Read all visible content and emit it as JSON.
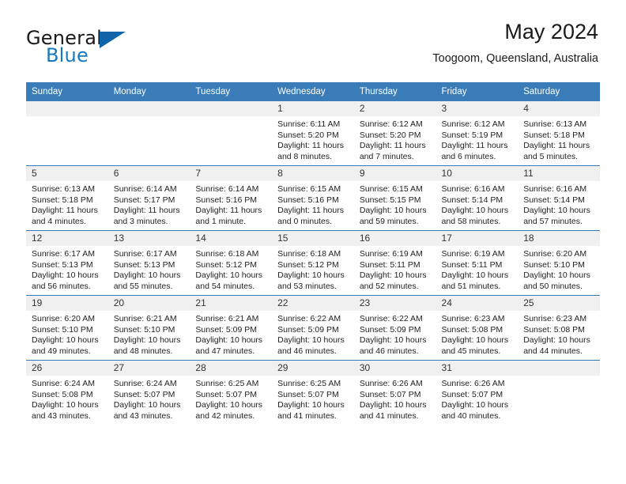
{
  "brand": {
    "name_top": "General",
    "name_bottom": "Blue",
    "accent_color": "#1879bf"
  },
  "header": {
    "title": "May 2024",
    "subtitle": "Toogoom, Queensland, Australia"
  },
  "calendar": {
    "header_bg": "#3a7cb8",
    "daynum_bg": "#f0f0f0",
    "weekday_headers": [
      "Sunday",
      "Monday",
      "Tuesday",
      "Wednesday",
      "Thursday",
      "Friday",
      "Saturday"
    ],
    "labels": {
      "sunrise": "Sunrise:",
      "sunset": "Sunset:",
      "daylight": "Daylight:"
    },
    "weeks": [
      [
        {
          "day": "",
          "empty": true
        },
        {
          "day": "",
          "empty": true
        },
        {
          "day": "",
          "empty": true
        },
        {
          "day": "1",
          "sunrise": "Sunrise: 6:11 AM",
          "sunset": "Sunset: 5:20 PM",
          "daylight_1": "Daylight: 11 hours",
          "daylight_2": "and 8 minutes."
        },
        {
          "day": "2",
          "sunrise": "Sunrise: 6:12 AM",
          "sunset": "Sunset: 5:20 PM",
          "daylight_1": "Daylight: 11 hours",
          "daylight_2": "and 7 minutes."
        },
        {
          "day": "3",
          "sunrise": "Sunrise: 6:12 AM",
          "sunset": "Sunset: 5:19 PM",
          "daylight_1": "Daylight: 11 hours",
          "daylight_2": "and 6 minutes."
        },
        {
          "day": "4",
          "sunrise": "Sunrise: 6:13 AM",
          "sunset": "Sunset: 5:18 PM",
          "daylight_1": "Daylight: 11 hours",
          "daylight_2": "and 5 minutes."
        }
      ],
      [
        {
          "day": "5",
          "sunrise": "Sunrise: 6:13 AM",
          "sunset": "Sunset: 5:18 PM",
          "daylight_1": "Daylight: 11 hours",
          "daylight_2": "and 4 minutes."
        },
        {
          "day": "6",
          "sunrise": "Sunrise: 6:14 AM",
          "sunset": "Sunset: 5:17 PM",
          "daylight_1": "Daylight: 11 hours",
          "daylight_2": "and 3 minutes."
        },
        {
          "day": "7",
          "sunrise": "Sunrise: 6:14 AM",
          "sunset": "Sunset: 5:16 PM",
          "daylight_1": "Daylight: 11 hours",
          "daylight_2": "and 1 minute."
        },
        {
          "day": "8",
          "sunrise": "Sunrise: 6:15 AM",
          "sunset": "Sunset: 5:16 PM",
          "daylight_1": "Daylight: 11 hours",
          "daylight_2": "and 0 minutes."
        },
        {
          "day": "9",
          "sunrise": "Sunrise: 6:15 AM",
          "sunset": "Sunset: 5:15 PM",
          "daylight_1": "Daylight: 10 hours",
          "daylight_2": "and 59 minutes."
        },
        {
          "day": "10",
          "sunrise": "Sunrise: 6:16 AM",
          "sunset": "Sunset: 5:14 PM",
          "daylight_1": "Daylight: 10 hours",
          "daylight_2": "and 58 minutes."
        },
        {
          "day": "11",
          "sunrise": "Sunrise: 6:16 AM",
          "sunset": "Sunset: 5:14 PM",
          "daylight_1": "Daylight: 10 hours",
          "daylight_2": "and 57 minutes."
        }
      ],
      [
        {
          "day": "12",
          "sunrise": "Sunrise: 6:17 AM",
          "sunset": "Sunset: 5:13 PM",
          "daylight_1": "Daylight: 10 hours",
          "daylight_2": "and 56 minutes."
        },
        {
          "day": "13",
          "sunrise": "Sunrise: 6:17 AM",
          "sunset": "Sunset: 5:13 PM",
          "daylight_1": "Daylight: 10 hours",
          "daylight_2": "and 55 minutes."
        },
        {
          "day": "14",
          "sunrise": "Sunrise: 6:18 AM",
          "sunset": "Sunset: 5:12 PM",
          "daylight_1": "Daylight: 10 hours",
          "daylight_2": "and 54 minutes."
        },
        {
          "day": "15",
          "sunrise": "Sunrise: 6:18 AM",
          "sunset": "Sunset: 5:12 PM",
          "daylight_1": "Daylight: 10 hours",
          "daylight_2": "and 53 minutes."
        },
        {
          "day": "16",
          "sunrise": "Sunrise: 6:19 AM",
          "sunset": "Sunset: 5:11 PM",
          "daylight_1": "Daylight: 10 hours",
          "daylight_2": "and 52 minutes."
        },
        {
          "day": "17",
          "sunrise": "Sunrise: 6:19 AM",
          "sunset": "Sunset: 5:11 PM",
          "daylight_1": "Daylight: 10 hours",
          "daylight_2": "and 51 minutes."
        },
        {
          "day": "18",
          "sunrise": "Sunrise: 6:20 AM",
          "sunset": "Sunset: 5:10 PM",
          "daylight_1": "Daylight: 10 hours",
          "daylight_2": "and 50 minutes."
        }
      ],
      [
        {
          "day": "19",
          "sunrise": "Sunrise: 6:20 AM",
          "sunset": "Sunset: 5:10 PM",
          "daylight_1": "Daylight: 10 hours",
          "daylight_2": "and 49 minutes."
        },
        {
          "day": "20",
          "sunrise": "Sunrise: 6:21 AM",
          "sunset": "Sunset: 5:10 PM",
          "daylight_1": "Daylight: 10 hours",
          "daylight_2": "and 48 minutes."
        },
        {
          "day": "21",
          "sunrise": "Sunrise: 6:21 AM",
          "sunset": "Sunset: 5:09 PM",
          "daylight_1": "Daylight: 10 hours",
          "daylight_2": "and 47 minutes."
        },
        {
          "day": "22",
          "sunrise": "Sunrise: 6:22 AM",
          "sunset": "Sunset: 5:09 PM",
          "daylight_1": "Daylight: 10 hours",
          "daylight_2": "and 46 minutes."
        },
        {
          "day": "23",
          "sunrise": "Sunrise: 6:22 AM",
          "sunset": "Sunset: 5:09 PM",
          "daylight_1": "Daylight: 10 hours",
          "daylight_2": "and 46 minutes."
        },
        {
          "day": "24",
          "sunrise": "Sunrise: 6:23 AM",
          "sunset": "Sunset: 5:08 PM",
          "daylight_1": "Daylight: 10 hours",
          "daylight_2": "and 45 minutes."
        },
        {
          "day": "25",
          "sunrise": "Sunrise: 6:23 AM",
          "sunset": "Sunset: 5:08 PM",
          "daylight_1": "Daylight: 10 hours",
          "daylight_2": "and 44 minutes."
        }
      ],
      [
        {
          "day": "26",
          "sunrise": "Sunrise: 6:24 AM",
          "sunset": "Sunset: 5:08 PM",
          "daylight_1": "Daylight: 10 hours",
          "daylight_2": "and 43 minutes."
        },
        {
          "day": "27",
          "sunrise": "Sunrise: 6:24 AM",
          "sunset": "Sunset: 5:07 PM",
          "daylight_1": "Daylight: 10 hours",
          "daylight_2": "and 43 minutes."
        },
        {
          "day": "28",
          "sunrise": "Sunrise: 6:25 AM",
          "sunset": "Sunset: 5:07 PM",
          "daylight_1": "Daylight: 10 hours",
          "daylight_2": "and 42 minutes."
        },
        {
          "day": "29",
          "sunrise": "Sunrise: 6:25 AM",
          "sunset": "Sunset: 5:07 PM",
          "daylight_1": "Daylight: 10 hours",
          "daylight_2": "and 41 minutes."
        },
        {
          "day": "30",
          "sunrise": "Sunrise: 6:26 AM",
          "sunset": "Sunset: 5:07 PM",
          "daylight_1": "Daylight: 10 hours",
          "daylight_2": "and 41 minutes."
        },
        {
          "day": "31",
          "sunrise": "Sunrise: 6:26 AM",
          "sunset": "Sunset: 5:07 PM",
          "daylight_1": "Daylight: 10 hours",
          "daylight_2": "and 40 minutes."
        },
        {
          "day": "",
          "empty": true
        }
      ]
    ]
  }
}
